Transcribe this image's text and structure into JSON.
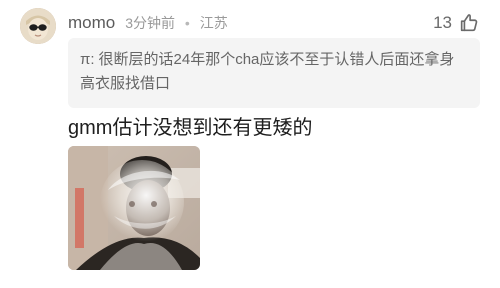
{
  "comment": {
    "author": {
      "username": "momo",
      "avatar_icon": "avatar-person-sunglasses"
    },
    "time": "3分钟前",
    "separator": "•",
    "location": "江苏",
    "likes": {
      "count": "13",
      "icon": "thumbs-up-outline-icon"
    },
    "quote": {
      "author": "π:",
      "text": "很断层的话24年那个cha应该不至于认错人后面还拿身高衣服找借口"
    },
    "text": "gmm估计没想到还有更矮的",
    "image": {
      "kind": "photo",
      "colors": {
        "background": "#d9cfc3",
        "foreground": "#2b2622"
      }
    }
  }
}
